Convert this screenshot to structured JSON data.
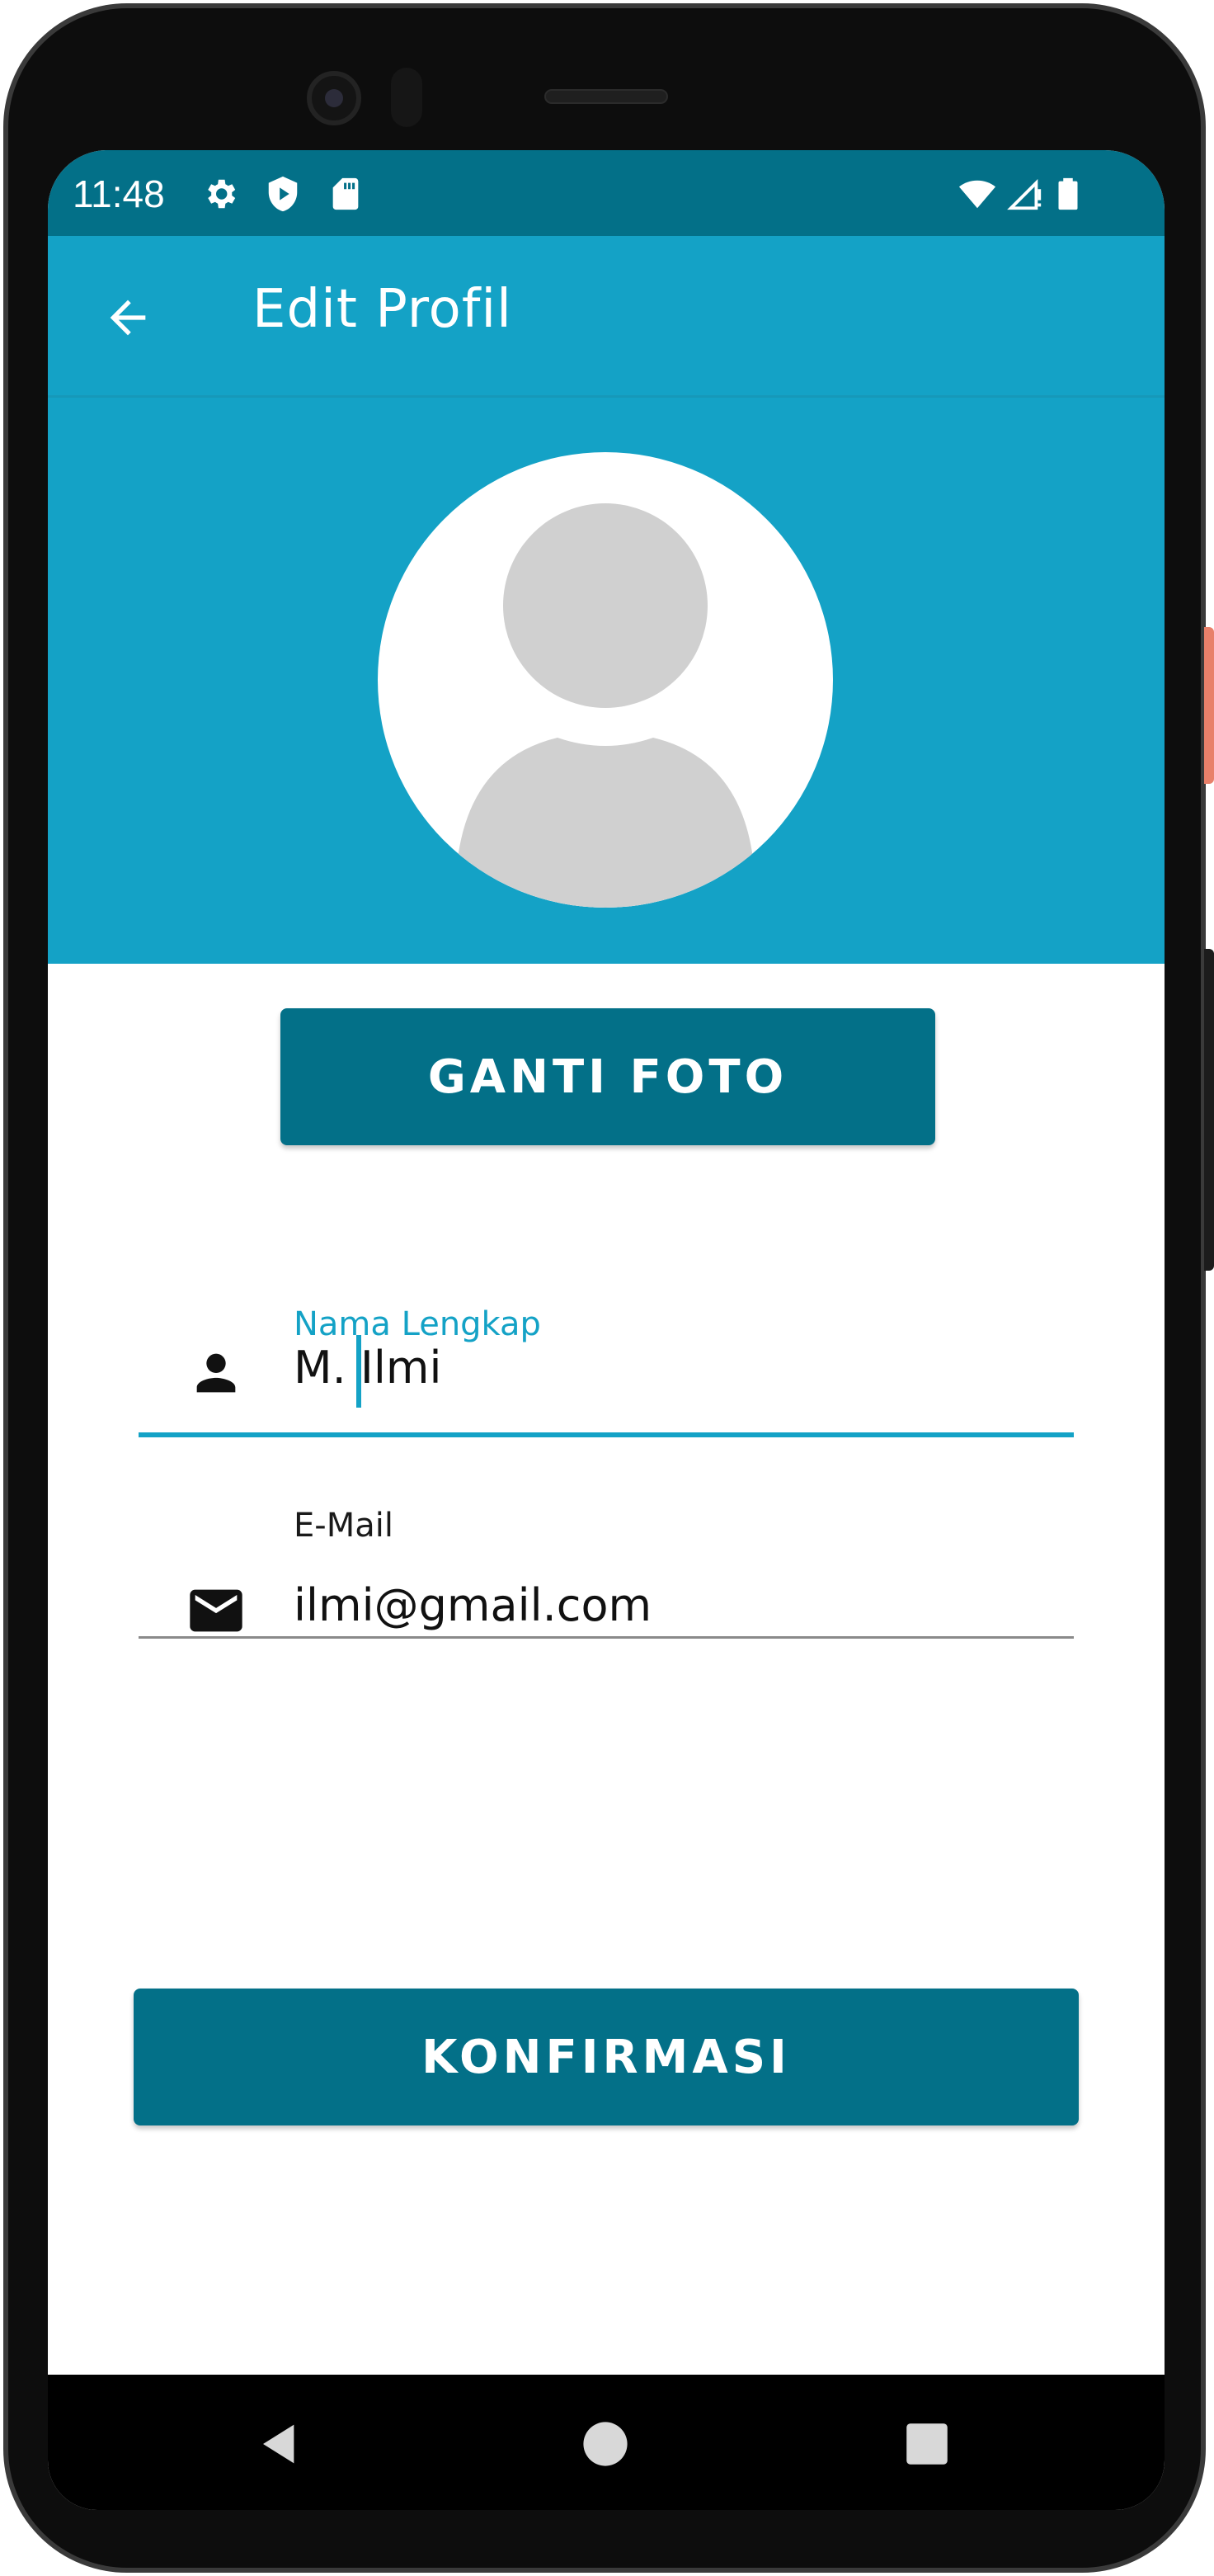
{
  "status_bar": {
    "time": "11:48",
    "left_icons": [
      "gear-icon",
      "shield-play-icon",
      "sd-card-icon"
    ],
    "right_icons": [
      "wifi-icon",
      "signal-icon",
      "battery-icon"
    ]
  },
  "app_bar": {
    "title": "Edit Profil",
    "back_icon": "arrow-left-icon"
  },
  "profile": {
    "avatar_icon": "default-person-avatar"
  },
  "buttons": {
    "change_photo": "GANTI FOTO",
    "confirm": "KONFIRMASI"
  },
  "form": {
    "name_field": {
      "label": "Nama Lengkap",
      "value": "M. Ilmi",
      "icon": "person-icon"
    },
    "email_field": {
      "label": "E-Mail",
      "value": "ilmi@gmail.com",
      "icon": "mail-icon"
    }
  },
  "nav_bar": {
    "icons": [
      "back-triangle-icon",
      "home-circle-icon",
      "recents-square-icon"
    ]
  },
  "colors": {
    "primary": "#14a2c6",
    "primary_dark": "#037088",
    "button_text": "#ffffff",
    "background": "#ffffff"
  }
}
